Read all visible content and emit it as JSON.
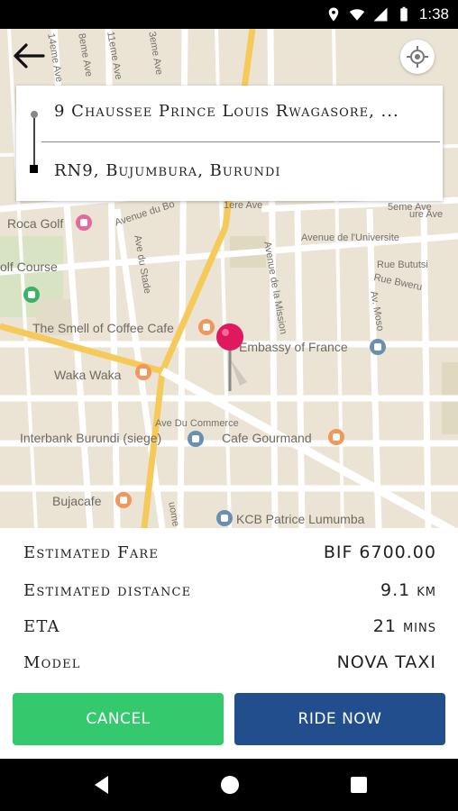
{
  "status_bar": {
    "time": "1:38",
    "icons": [
      "location-icon",
      "wifi-icon",
      "signal-icon",
      "battery-icon"
    ]
  },
  "map": {
    "labels": {
      "roca_golf": "Roca Golf",
      "golf_course": "olf Course",
      "smell_of_coffee": "The Smell of Coffee Cafe",
      "waka_waka": "Waka Waka",
      "embassy_of_france": "Embassy of France",
      "interbank": "Interbank Burundi (siege)",
      "ave_du_commerce": "Ave Du Commerce",
      "cafe_gourmand": "Cafe Gourmand",
      "bujacafe": "Bujacafe",
      "kcb": "KCB Patrice Lumumba",
      "avenue_de_universite": "Avenue de l'Universite",
      "rue_bututsi": "Rue Bututsi",
      "rue_bweru": "Rue Bweru",
      "ave_du_stade": "Ave du Stade",
      "avenue_de_la_mission": "Avenue de la Mission",
      "avenue_bo": "Avenue du Bo",
      "ieme_ave_3": "3eme Ave",
      "ieme_ave_11": "11eme Ave",
      "ieme_ave_14": "14eme Ave",
      "ieme_ave_8": "8eme Ave",
      "ieme_ave_5": "5eme Ave",
      "ave_mo": "Av. Moso",
      "ave_iere": "1ere Ave",
      "ave_ure": "ure Ave",
      "ave_uome": "uome"
    },
    "accent_pin_color": "#e0195e"
  },
  "route": {
    "from": "9 Chaussee Prince Louis Rwagasore, ...",
    "to": "RN9, Bujumbura, Burundi"
  },
  "trip_info": {
    "rows": [
      {
        "label": "Estimated Fare",
        "value": "BIF 6700.00"
      },
      {
        "label": "Estimated distance",
        "value": "9.1 km"
      },
      {
        "label": "ETA",
        "value": "21 mins"
      },
      {
        "label": "Model",
        "value": "NOVA TAXI"
      }
    ]
  },
  "actions": {
    "cancel_label": "CANCEL",
    "ride_now_label": "RIDE NOW",
    "cancel_color": "#34c96d",
    "ride_now_color": "#234e8e"
  },
  "nav_bar": {
    "icons": [
      "back-triangle-icon",
      "home-circle-icon",
      "recents-square-icon"
    ]
  }
}
